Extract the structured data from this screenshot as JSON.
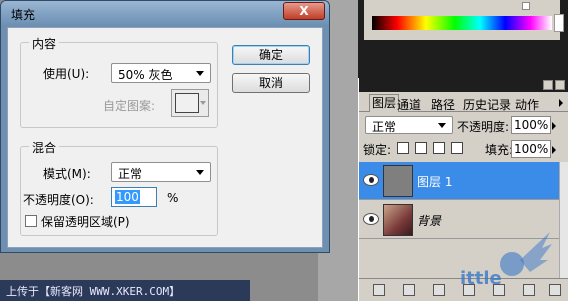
{
  "dialog": {
    "title": "填充",
    "close_label": "X",
    "ok_label": "确定",
    "cancel_label": "取消",
    "contents": {
      "group_label": "内容",
      "use_label": "使用(U):",
      "use_value": "50% 灰色",
      "custom_pattern_label": "自定图案:"
    },
    "blending": {
      "group_label": "混合",
      "mode_label": "模式(M):",
      "mode_value": "正常",
      "opacity_label": "不透明度(O):",
      "opacity_value": "100",
      "opacity_unit": "%",
      "preserve_label": "保留透明区域(P)",
      "preserve_checked": false
    }
  },
  "layers_panel": {
    "tabs": [
      "图层",
      "通道",
      "路径",
      "历史记录",
      "动作"
    ],
    "blend_mode": "正常",
    "opacity_label": "不透明度:",
    "opacity_value": "100%",
    "lock_label": "锁定:",
    "fill_label": "填充:",
    "fill_value": "100%",
    "layers": [
      {
        "name": "图层 1",
        "selected": true,
        "thumb_color": "#7f7f7f"
      },
      {
        "name": "背景",
        "selected": false,
        "thumb_color": "#7a3a3a"
      }
    ]
  },
  "watermark": {
    "text": "ittle"
  },
  "caption": {
    "text": "上传于【新客网 WWW.XKER.COM】"
  },
  "colors": {
    "accent_selected": "#3a8ce8",
    "titlebar": "#6d90b4",
    "close_button": "#c13e27"
  }
}
